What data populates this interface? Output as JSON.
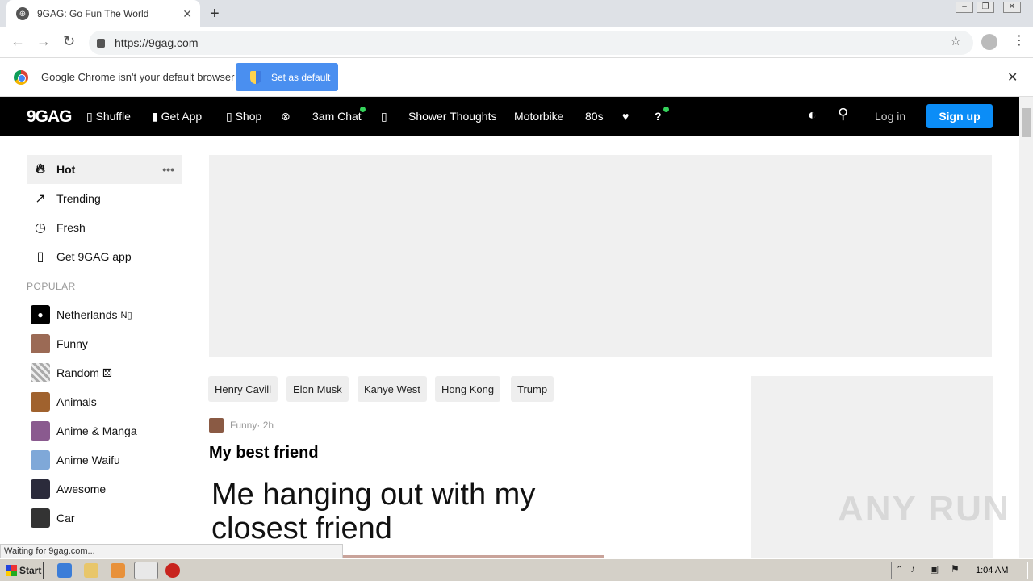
{
  "browser": {
    "tab_title": "9GAG: Go Fun The World",
    "url": "https://9gag.com",
    "infobar_text": "Google Chrome isn't your default browser",
    "set_default_label": "Set as default"
  },
  "header": {
    "logo": "9GAG",
    "nav": [
      "Shuffle",
      "Get App",
      "Shop",
      "3am Chat",
      "Shower Thoughts",
      "Motorbike",
      "80s",
      "?"
    ],
    "login": "Log in",
    "signup": "Sign up"
  },
  "sidebar": {
    "main": [
      "Hot",
      "Trending",
      "Fresh",
      "Get 9GAG app"
    ],
    "popular_heading": "POPULAR",
    "popular": [
      "Netherlands",
      "Funny",
      "Random",
      "Animals",
      "Anime & Manga",
      "Anime Waifu",
      "Awesome",
      "Car"
    ]
  },
  "tags": [
    "Henry Cavill",
    "Elon Musk",
    "Kanye West",
    "Hong Kong",
    "Trump"
  ],
  "post": {
    "section": "Funny",
    "time": " · 2h",
    "title": "My best friend",
    "image_text": "Me hanging out with my closest friend"
  },
  "status_text": "Waiting for 9gag.com...",
  "taskbar": {
    "start": "Start",
    "clock": "1:04 AM"
  },
  "watermark": "ANY RUN"
}
